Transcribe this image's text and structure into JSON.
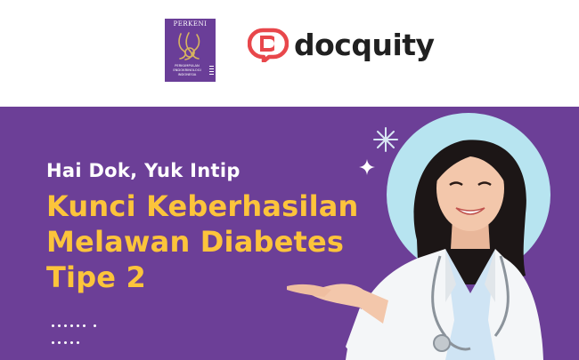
{
  "logos": {
    "perkeni": {
      "name": "PERKENI",
      "subtitle": "PERKUMPULAN\nENDOKRINOLOGI\nINDONESIA",
      "color": "#6a3e98"
    },
    "docquity": {
      "name": "docquity",
      "icon": "speech-bubble-d-icon",
      "icon_color": "#e8474b"
    }
  },
  "banner": {
    "intro": "Hai Dok, Yuk Intip",
    "headline_lines": [
      "Kunci Keberhasilan",
      "Melawan Diabetes",
      "Tipe 2"
    ],
    "background_color": "#6c3f97",
    "intro_color": "#ffffff",
    "headline_color": "#fcc43b",
    "circle_color": "#b7e4f0"
  }
}
